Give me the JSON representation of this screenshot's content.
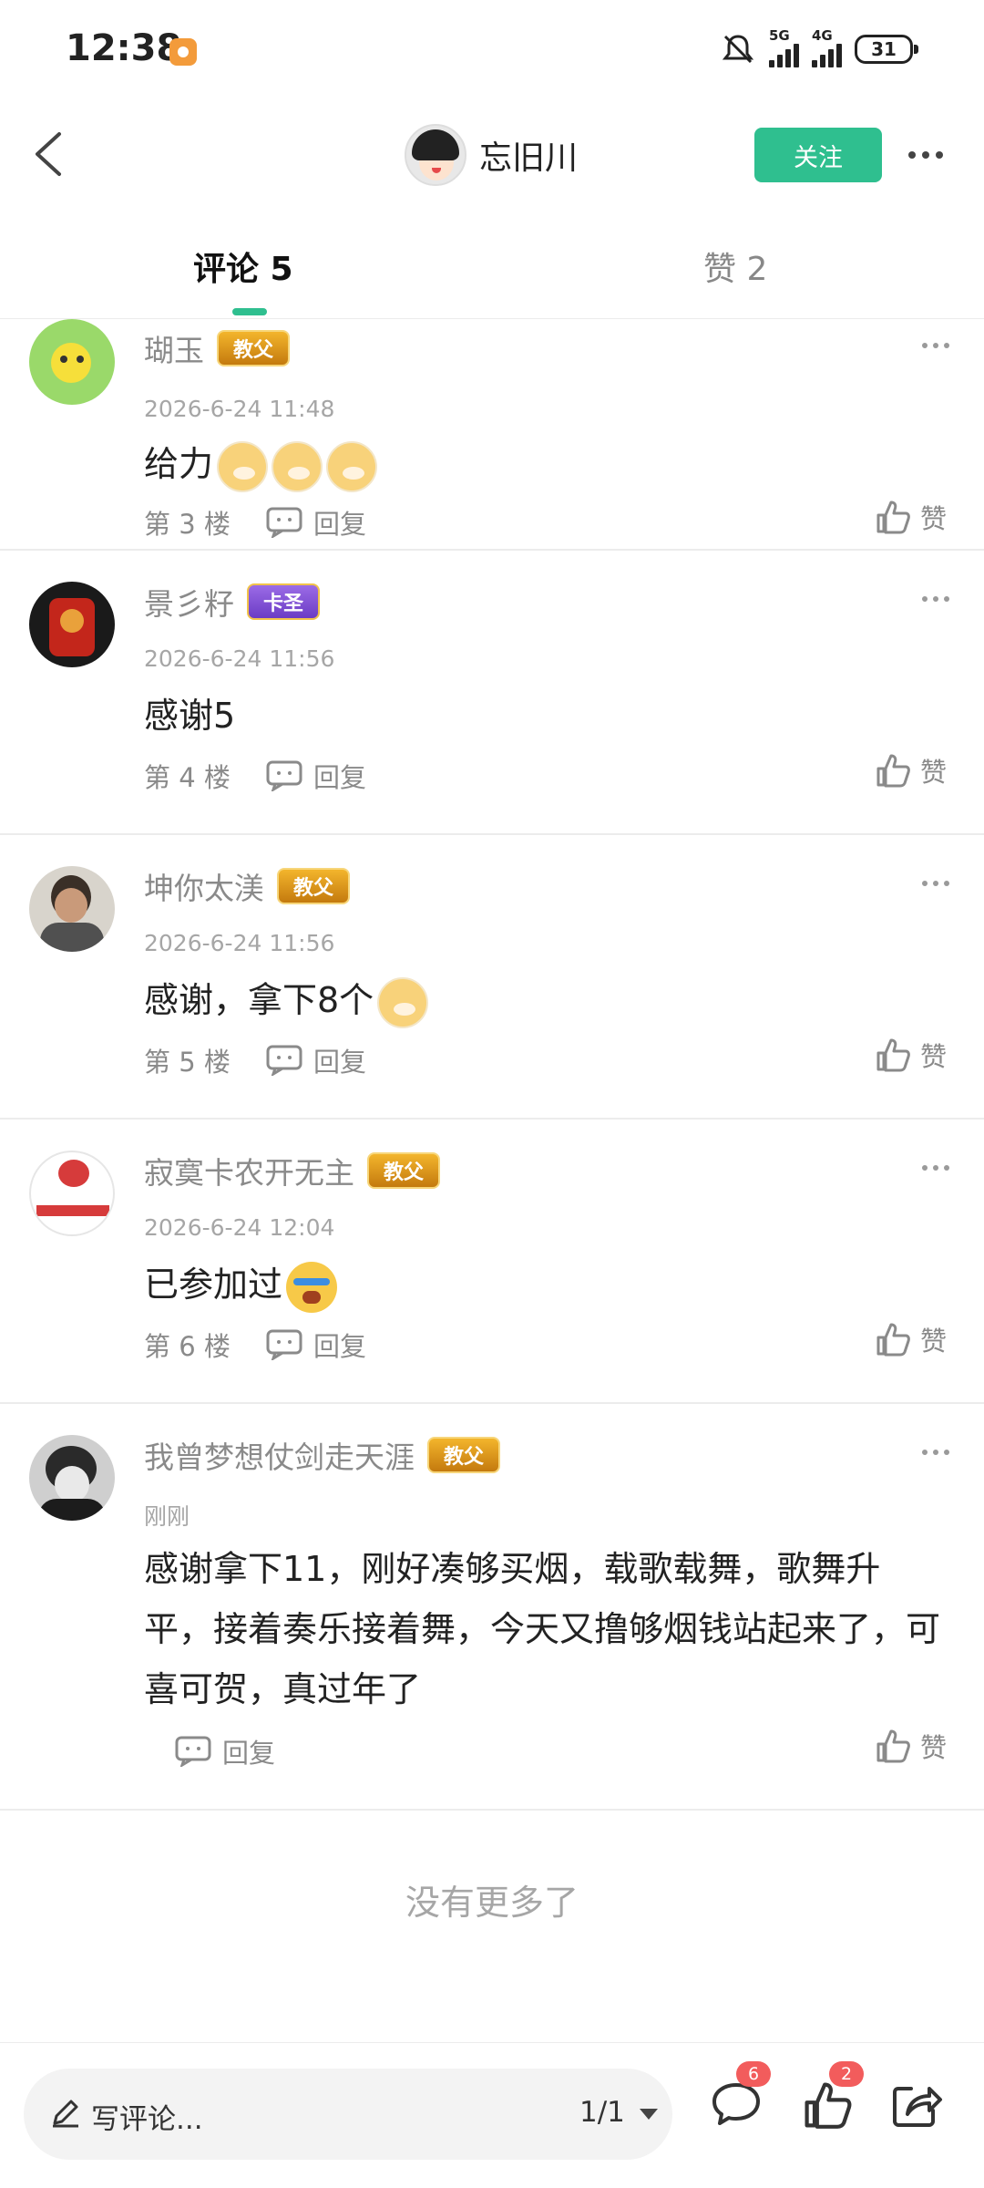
{
  "status_bar": {
    "time": "12:38",
    "network1": "5G",
    "network2": "4G",
    "battery": "31"
  },
  "header": {
    "username": "忘旧川",
    "follow_label": "关注"
  },
  "tabs": [
    {
      "label": "评论 5"
    },
    {
      "label": "赞 2"
    }
  ],
  "comments": [
    {
      "username": "瑚玉",
      "badge": "教父",
      "timestamp": "2026-6-24 11:48",
      "content": "给力",
      "floor": "第 3 楼",
      "reply_label": "回复",
      "like_label": "赞"
    },
    {
      "username": "景彡籽",
      "badge": "卡圣",
      "timestamp": "2026-6-24 11:56",
      "content": "感谢5",
      "floor": "第 4 楼",
      "reply_label": "回复",
      "like_label": "赞"
    },
    {
      "username": "坤你太渼",
      "badge": "教父",
      "timestamp": "2026-6-24 11:56",
      "content": "感谢，拿下8个",
      "floor": "第 5 楼",
      "reply_label": "回复",
      "like_label": "赞"
    },
    {
      "username": "寂寞卡农开无主",
      "badge": "教父",
      "timestamp": "2026-6-24 12:04",
      "content": "已参加过",
      "floor": "第 6 楼",
      "reply_label": "回复",
      "like_label": "赞"
    },
    {
      "username": "我曾梦想仗剑走天涯",
      "badge": "教父",
      "timestamp": "刚刚",
      "content": "感谢拿下11，刚好凑够买烟，载歌载舞，歌舞升平，接着奏乐接着舞，今天又撸够烟钱站起来了，可喜可贺，真过年了",
      "floor": "",
      "reply_label": "回复",
      "like_label": "赞"
    }
  ],
  "footer": {
    "no_more": "没有更多了"
  },
  "bottom_bar": {
    "placeholder": "写评论...",
    "page": "1/1",
    "comment_count": "6",
    "like_count": "2"
  },
  "colors": {
    "accent": "#2fbf8f",
    "badge_red": "#f25c5c"
  }
}
